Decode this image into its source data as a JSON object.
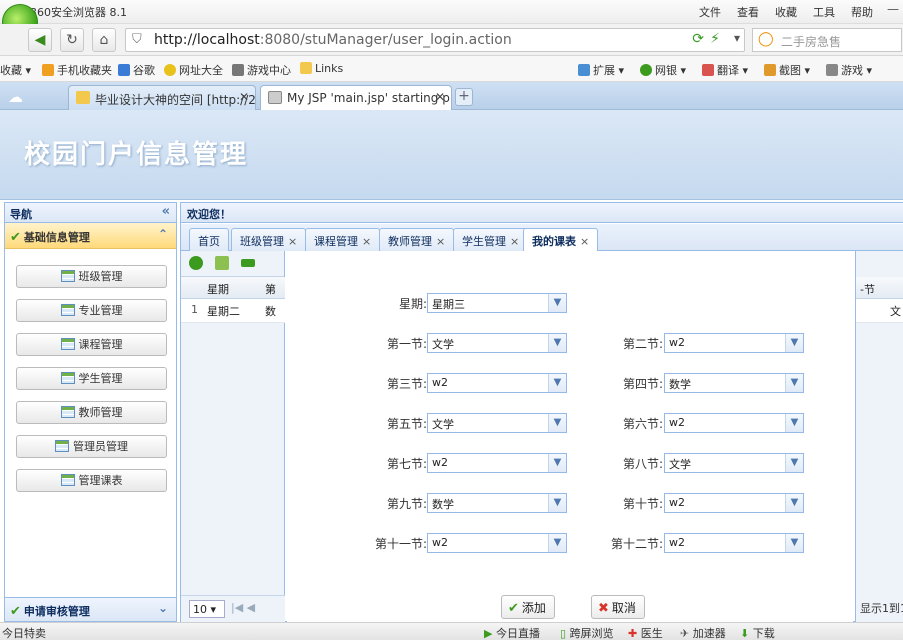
{
  "browser": {
    "app_title": "360安全浏览器 8.1",
    "menu": [
      "文件",
      "查看",
      "收藏",
      "工具",
      "帮助"
    ],
    "url_host": "http://localhost",
    "url_rest": ":8080/stuManager/user_login.action",
    "search_placeholder": "二手房急售",
    "favorites": [
      "收藏",
      "手机收藏夹",
      "谷歌",
      "网址大全",
      "游戏中心",
      "Links"
    ],
    "toolbar_right": [
      "扩展",
      "网银",
      "翻译",
      "截图",
      "游戏"
    ],
    "tabs": [
      {
        "label": "毕业设计大神的空间 [http://2"
      },
      {
        "label": "My JSP 'main.jsp' starting p"
      }
    ]
  },
  "page": {
    "banner_title": "校园门户信息管理",
    "nav": {
      "header": "导航",
      "section1": "基础信息管理",
      "items": [
        "班级管理",
        "专业管理",
        "课程管理",
        "学生管理",
        "教师管理",
        "管理员管理",
        "管理课表"
      ],
      "section2": "申请审核管理"
    },
    "center": {
      "welcome": "欢迎您！",
      "tabs": [
        "首页",
        "班级管理",
        "课程管理",
        "教师管理",
        "学生管理",
        "我的课表"
      ],
      "grid_left": {
        "headers": [
          "星期",
          "第"
        ],
        "row": {
          "index": "1",
          "day": "星期二",
          "first": "数"
        },
        "page_size": "10"
      },
      "grid_right": {
        "header": "-节",
        "row": "文",
        "pager_info": "显示1到1"
      }
    },
    "form": {
      "weekday_label": "星期:",
      "weekday_value": "星期三",
      "periods": [
        {
          "label": "第一节:",
          "value": "文学"
        },
        {
          "label": "第二节:",
          "value": "w2"
        },
        {
          "label": "第三节:",
          "value": "w2"
        },
        {
          "label": "第四节:",
          "value": "数学"
        },
        {
          "label": "第五节:",
          "value": "文学"
        },
        {
          "label": "第六节:",
          "value": "w2"
        },
        {
          "label": "第七节:",
          "value": "w2"
        },
        {
          "label": "第八节:",
          "value": "文学"
        },
        {
          "label": "第九节:",
          "value": "数学"
        },
        {
          "label": "第十节:",
          "value": "w2"
        },
        {
          "label": "第十一节:",
          "value": "w2"
        },
        {
          "label": "第十二节:",
          "value": "w2"
        }
      ],
      "add_label": "添加",
      "cancel_label": "取消"
    }
  },
  "statusbar": {
    "left": "今日特卖",
    "items": [
      "今日直播",
      "跨屏浏览",
      "医生",
      "加速器",
      "下载"
    ]
  },
  "colors": {
    "accent_blue": "#99bbe8",
    "banner_bg": "#c5d9ef",
    "accordion_yellow": "#ffd97a",
    "check_green": "#3c9a1e"
  }
}
